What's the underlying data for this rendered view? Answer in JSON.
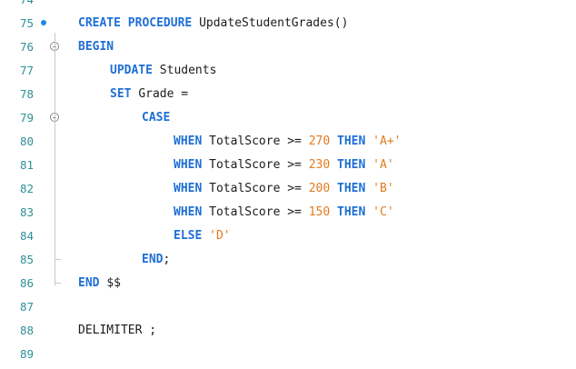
{
  "editor": {
    "partial_top_line": "74",
    "lines": [
      {
        "num": "75",
        "indent": 0,
        "marker": "breakpoint",
        "tokens": [
          {
            "t": "CREATE PROCEDURE ",
            "c": "kw"
          },
          {
            "t": "UpdateStudentGrades()",
            "c": "id"
          }
        ]
      },
      {
        "num": "76",
        "indent": 0,
        "marker": "fold",
        "tokens": [
          {
            "t": "BEGIN",
            "c": "kw"
          }
        ]
      },
      {
        "num": "77",
        "indent": 1,
        "marker": "",
        "tokens": [
          {
            "t": "UPDATE ",
            "c": "kw"
          },
          {
            "t": "Students",
            "c": "id"
          }
        ]
      },
      {
        "num": "78",
        "indent": 1,
        "marker": "",
        "tokens": [
          {
            "t": "SET ",
            "c": "kw"
          },
          {
            "t": "Grade =",
            "c": "id"
          }
        ]
      },
      {
        "num": "79",
        "indent": 2,
        "marker": "fold",
        "tokens": [
          {
            "t": "CASE",
            "c": "kw"
          }
        ]
      },
      {
        "num": "80",
        "indent": 3,
        "marker": "",
        "tokens": [
          {
            "t": "WHEN ",
            "c": "kw"
          },
          {
            "t": "TotalScore ",
            "c": "id"
          },
          {
            "t": ">= ",
            "c": "op"
          },
          {
            "t": "270 ",
            "c": "num"
          },
          {
            "t": "THEN ",
            "c": "kw"
          },
          {
            "t": "'A+'",
            "c": "str"
          }
        ]
      },
      {
        "num": "81",
        "indent": 3,
        "marker": "",
        "tokens": [
          {
            "t": "WHEN ",
            "c": "kw"
          },
          {
            "t": "TotalScore ",
            "c": "id"
          },
          {
            "t": ">= ",
            "c": "op"
          },
          {
            "t": "230 ",
            "c": "num"
          },
          {
            "t": "THEN ",
            "c": "kw"
          },
          {
            "t": "'A'",
            "c": "str"
          }
        ]
      },
      {
        "num": "82",
        "indent": 3,
        "marker": "",
        "tokens": [
          {
            "t": "WHEN ",
            "c": "kw"
          },
          {
            "t": "TotalScore ",
            "c": "id"
          },
          {
            "t": ">= ",
            "c": "op"
          },
          {
            "t": "200 ",
            "c": "num"
          },
          {
            "t": "THEN ",
            "c": "kw"
          },
          {
            "t": "'B'",
            "c": "str"
          }
        ]
      },
      {
        "num": "83",
        "indent": 3,
        "marker": "",
        "tokens": [
          {
            "t": "WHEN ",
            "c": "kw"
          },
          {
            "t": "TotalScore ",
            "c": "id"
          },
          {
            "t": ">= ",
            "c": "op"
          },
          {
            "t": "150 ",
            "c": "num"
          },
          {
            "t": "THEN ",
            "c": "kw"
          },
          {
            "t": "'C'",
            "c": "str"
          }
        ]
      },
      {
        "num": "84",
        "indent": 3,
        "marker": "",
        "tokens": [
          {
            "t": "ELSE ",
            "c": "kw"
          },
          {
            "t": "'D'",
            "c": "str"
          }
        ]
      },
      {
        "num": "85",
        "indent": 2,
        "marker": "fold-end",
        "tokens": [
          {
            "t": "END",
            "c": "kw"
          },
          {
            "t": ";",
            "c": "id"
          }
        ]
      },
      {
        "num": "86",
        "indent": 0,
        "marker": "fold-end",
        "tokens": [
          {
            "t": "END ",
            "c": "kw"
          },
          {
            "t": "$$",
            "c": "id"
          }
        ]
      },
      {
        "num": "87",
        "indent": 0,
        "marker": "",
        "tokens": []
      },
      {
        "num": "88",
        "indent": 0,
        "marker": "",
        "tokens": [
          {
            "t": "DELIMITER ;",
            "c": "id"
          }
        ]
      },
      {
        "num": "89",
        "indent": 0,
        "marker": "",
        "tokens": []
      }
    ]
  },
  "colors": {
    "keyword": "#1f6fd6",
    "number": "#e07b20",
    "string": "#e07b20",
    "line_number": "#2f8f98",
    "breakpoint": "#1e88e5"
  }
}
